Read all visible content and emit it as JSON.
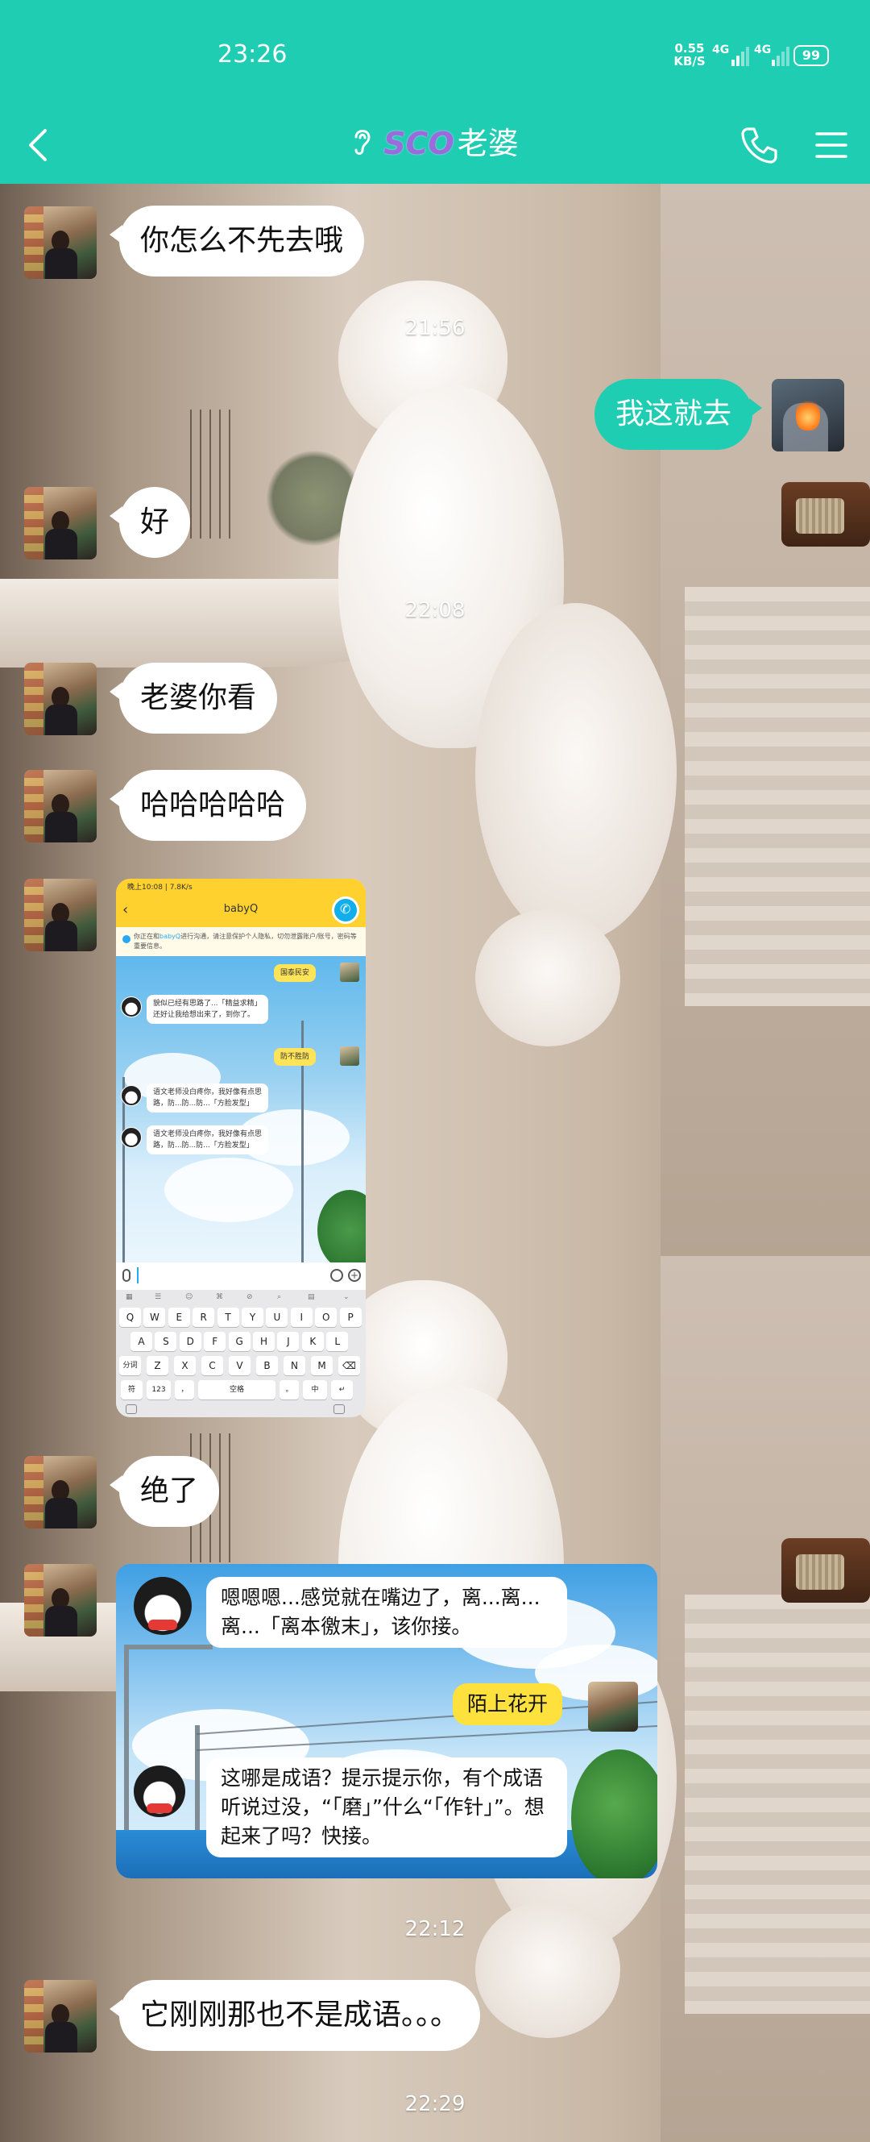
{
  "status_bar": {
    "time": "23:26",
    "net_speed_value": "0.55",
    "net_speed_unit": "KB/S",
    "network_label_1": "4G",
    "network_label_2": "4G",
    "battery": "99"
  },
  "header": {
    "title_accent": "SCO",
    "title": "老婆"
  },
  "messages": {
    "m1": "你怎么不先去哦",
    "t1": "21:56",
    "m2": "我这就去",
    "m3": "好",
    "t2": "22:08",
    "m4": "老婆你看",
    "m5": "哈哈哈哈哈",
    "m6": "绝了",
    "t3": "22:12",
    "m7": "它刚刚那也不是成语。。。",
    "t4": "22:29"
  },
  "screenshot": {
    "status": "晚上10:08 | 7.8K/s",
    "title": "babyQ",
    "tip_pre": "你正在和",
    "tip_link": "babyQ",
    "tip_post": "进行沟通，请注意保护个人隐私，切勿泄露账户/账号，密码等重要信息。",
    "b1": "国泰民安",
    "b2_line1": "貌似已经有思路了...「精益求精」",
    "b2_line2": "还好让我给想出来了，到你了。",
    "b3": "防不胜防",
    "b4_line1": "语文老师没白疼你，我好像有点思",
    "b4_line2": "路，防...防...防...「方脸发型」",
    "b5_line1": "语文老师没白疼你，我好像有点思",
    "b5_line2": "路，防...防...防...「方脸发型」",
    "keys_row1": [
      "Q",
      "W",
      "E",
      "R",
      "T",
      "Y",
      "U",
      "I",
      "O",
      "P"
    ],
    "keys_row2": [
      "A",
      "S",
      "D",
      "F",
      "G",
      "H",
      "J",
      "K",
      "L"
    ],
    "keys_row3": [
      "分词",
      "Z",
      "X",
      "C",
      "V",
      "B",
      "N",
      "M",
      "⌫"
    ],
    "keys_row4": [
      "符",
      "123",
      "，",
      "空格",
      "。",
      "中",
      "↵"
    ]
  },
  "crop": {
    "b1_line1": "嗯嗯嗯...感觉就在嘴边了，离...离...",
    "b1_line2": "离...「离本徼末」，该你接。",
    "b2": "陌上花开",
    "b3_line1": "这哪是成语？提示提示你，有个成语",
    "b3_line2": "听说过没，“「磨」”什么“「作针」”。想",
    "b3_line3": "起来了吗？快接。"
  },
  "colors": {
    "accent": "#1ecdb2",
    "bubble_left": "#ffffff",
    "bubble_right": "#1ecdb2"
  }
}
